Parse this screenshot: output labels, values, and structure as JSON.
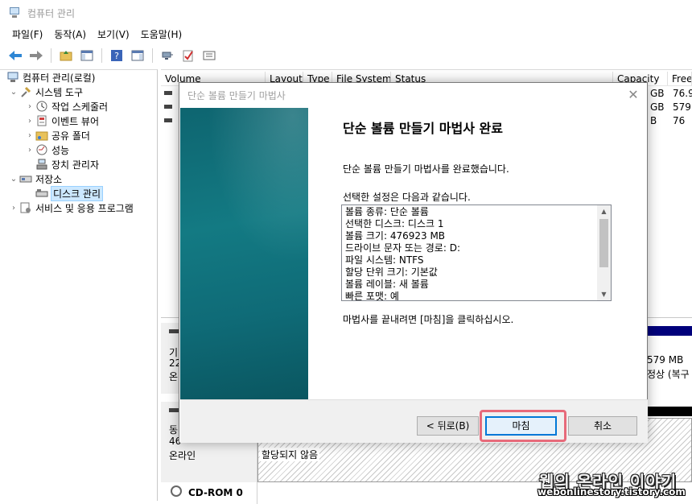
{
  "window": {
    "title": "컴퓨터 관리"
  },
  "menu": [
    "파일(F)",
    "동작(A)",
    "보기(V)",
    "도움말(H)"
  ],
  "tree": {
    "root": "컴퓨터 관리(로컬)",
    "system_tools": "시스템 도구",
    "task_scheduler": "작업 스케줄러",
    "event_viewer": "이벤트 뷰어",
    "shared_folders": "공유 폴더",
    "performance": "성능",
    "device_manager": "장치 관리자",
    "storage": "저장소",
    "disk_management": "디스크 관리",
    "services_apps": "서비스 및 응용 프로그램"
  },
  "columns": [
    "Volume",
    "Layout",
    "Type",
    "File System",
    "Status",
    "Capacity",
    "Free"
  ],
  "volume_rows": [
    {
      "capacity": "GB",
      "free": "76.9"
    },
    {
      "capacity": "GB",
      "free": "579"
    },
    {
      "capacity": "B",
      "free": "76"
    }
  ],
  "lower": {
    "disk0_label_a": "기",
    "disk0_label_b": "22",
    "disk0_label_c": "온라",
    "disk0_size": "579 MB",
    "disk0_status": "정상 (복구",
    "disk1_label_a": "동",
    "disk1_label_b": "46",
    "disk1_status": "온라인",
    "unallocated": "할당되지 않음",
    "cdrom": "CD-ROM 0"
  },
  "dialog": {
    "title": "단순 볼륨 만들기 마법사",
    "heading": "단순 볼륨 만들기 마법사 완료",
    "completed_text": "단순 볼륨 만들기 마법사를 완료했습니다.",
    "settings_label": "선택한 설정은 다음과 같습니다.",
    "summary": [
      "볼륨 종류: 단순 볼륨",
      "선택한 디스크: 디스크 1",
      "볼륨 크기: 476923 MB",
      "드라이브 문자 또는 경로: D:",
      "파일 시스템: NTFS",
      "할당 단위 크기: 기본값",
      "볼륨 레이블: 새 볼륨",
      "빠른 포맷: 예"
    ],
    "close_text": "마법사를 끝내려면 [마침]을 클릭하십시오.",
    "back_button": "< 뒤로(B)",
    "finish_button": "마침",
    "cancel_button": "취소"
  },
  "watermark": {
    "korean": "웹의 온라인 이야기",
    "url": "webonlinestory.tistory.com"
  },
  "colors": {
    "banner": "#137a83",
    "highlight": "#e76a7a",
    "selection": "#cce8ff",
    "disk_bar": "#00007b"
  }
}
